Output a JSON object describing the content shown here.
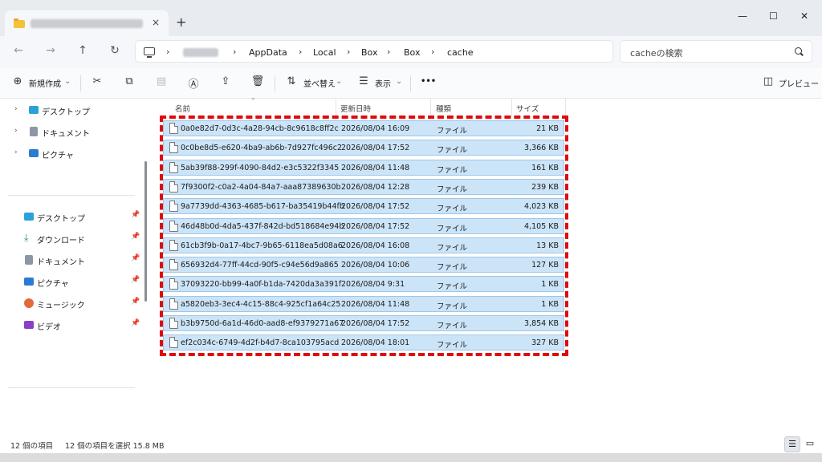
{
  "tab": {
    "close": "×",
    "new_tab": "+"
  },
  "window_controls": {
    "minimize": "—",
    "maximize": "☐",
    "close": "✕"
  },
  "nav": {
    "back": "←",
    "forward": "→",
    "up": "↑",
    "refresh": "↻"
  },
  "breadcrumb": {
    "items": [
      "AppData",
      "Local",
      "Box",
      "Box",
      "cache"
    ],
    "separator": "›"
  },
  "search": {
    "placeholder": "cacheの検索"
  },
  "toolbar": {
    "new_label": "新規作成",
    "sort_label": "並べ替え",
    "view_label": "表示",
    "more_label": "•••",
    "preview_label": "プレビュー"
  },
  "sidebar": {
    "top_items": [
      {
        "label": "デスクトップ",
        "icon": "desktop-icon"
      },
      {
        "label": "ドキュメント",
        "icon": "document-icon"
      },
      {
        "label": "ピクチャ",
        "icon": "picture-icon"
      }
    ],
    "quick_items": [
      {
        "label": "デスクトップ",
        "icon": "desktop-icon"
      },
      {
        "label": "ダウンロード",
        "icon": "download-icon"
      },
      {
        "label": "ドキュメント",
        "icon": "document-icon"
      },
      {
        "label": "ピクチャ",
        "icon": "picture-icon"
      },
      {
        "label": "ミュージック",
        "icon": "music-icon"
      },
      {
        "label": "ビデオ",
        "icon": "video-icon"
      }
    ]
  },
  "columns": {
    "name": "名前",
    "modified": "更新日時",
    "type": "種類",
    "size": "サイズ"
  },
  "files": [
    {
      "name": "0a0e82d7-0d3c-4a28-94cb-8c9618c8ff2c",
      "modified": "2026/08/04 16:09",
      "type": "ファイル",
      "size": "21 KB"
    },
    {
      "name": "0c0be8d5-e620-4ba9-ab6b-7d927fc496c2",
      "modified": "2026/08/04 17:52",
      "type": "ファイル",
      "size": "3,366 KB"
    },
    {
      "name": "5ab39f88-299f-4090-84d2-e3c5322f3345",
      "modified": "2026/08/04 11:48",
      "type": "ファイル",
      "size": "161 KB"
    },
    {
      "name": "7f9300f2-c0a2-4a04-84a7-aaa87389630b",
      "modified": "2026/08/04 12:28",
      "type": "ファイル",
      "size": "239 KB"
    },
    {
      "name": "9a7739dd-4363-4685-b617-ba35419b44fb",
      "modified": "2026/08/04 17:52",
      "type": "ファイル",
      "size": "4,023 KB"
    },
    {
      "name": "46d48b0d-4da5-437f-842d-bd518684e94b",
      "modified": "2026/08/04 17:52",
      "type": "ファイル",
      "size": "4,105 KB"
    },
    {
      "name": "61cb3f9b-0a17-4bc7-9b65-6118ea5d08a6",
      "modified": "2026/08/04 16:08",
      "type": "ファイル",
      "size": "13 KB"
    },
    {
      "name": "656932d4-77ff-44cd-90f5-c94e56d9a865",
      "modified": "2026/08/04 10:06",
      "type": "ファイル",
      "size": "127 KB"
    },
    {
      "name": "37093220-bb99-4a0f-b1da-7420da3a391f",
      "modified": "2026/08/04 9:31",
      "type": "ファイル",
      "size": "1 KB"
    },
    {
      "name": "a5820eb3-3ec4-4c15-88c4-925cf1a64c25",
      "modified": "2026/08/04 11:48",
      "type": "ファイル",
      "size": "1 KB"
    },
    {
      "name": "b3b9750d-6a1d-46d0-aad8-ef9379271a67",
      "modified": "2026/08/04 17:52",
      "type": "ファイル",
      "size": "3,854 KB"
    },
    {
      "name": "ef2c034c-6749-4d2f-b4d7-8ca103795acd",
      "modified": "2026/08/04 18:01",
      "type": "ファイル",
      "size": "327 KB"
    }
  ],
  "status": {
    "count": "12 個の項目",
    "selected": "12 個の項目を選択 15.8 MB"
  },
  "colors": {
    "selection": "#cce4f7",
    "selection_border": "#9fc7ea",
    "highlight_box": "#e00a0a",
    "accent": "#0067c0"
  }
}
